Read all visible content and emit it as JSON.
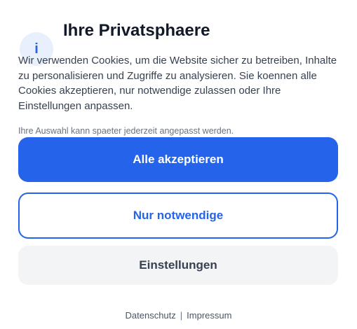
{
  "dialog": {
    "icon": "info-icon",
    "icon_glyph": "i",
    "title": "Ihre Privatsphaere",
    "description": "Wir verwenden Cookies, um die Website sicher zu betreiben, Inhalte zu personalisieren und Zugriffe zu analysieren. Sie koennen alle Cookies akzeptieren, nur notwendige zulassen oder Ihre Einstellungen anpassen.",
    "note": "Ihre Auswahl kann spaeter jederzeit angepasst werden."
  },
  "buttons": {
    "accept_all": "Alle akzeptieren",
    "necessary_only": "Nur notwendige",
    "settings": "Einstellungen"
  },
  "footer": {
    "privacy_link": "Datenschutz",
    "separator": "|",
    "imprint_link": "Impressum"
  },
  "colors": {
    "accent": "#2563eb",
    "icon_background": "#e8f0fe",
    "secondary_button_background": "#f3f4f6",
    "title_text": "#111827",
    "body_text": "#374151"
  }
}
